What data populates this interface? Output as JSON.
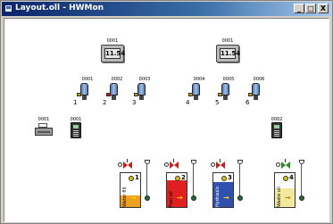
{
  "window": {
    "title": "Layout.oll - HWMon",
    "min_label": "_",
    "max_label": "□",
    "close_label": "X"
  },
  "displays": [
    {
      "tag": "0001",
      "value": "11.54"
    },
    {
      "tag": "0001",
      "value": "11.54"
    }
  ],
  "sensors": [
    {
      "tag": "0001",
      "number": "1",
      "cap": "yellow"
    },
    {
      "tag": "0002",
      "number": "2",
      "cap": "red"
    },
    {
      "tag": "0003",
      "number": "3",
      "cap": "yellow"
    },
    {
      "tag": "0004",
      "number": "4",
      "cap": "yellow"
    },
    {
      "tag": "0005",
      "number": "5",
      "cap": "yellow"
    },
    {
      "tag": "0006",
      "number": "6",
      "cap": "yellow"
    }
  ],
  "devices": {
    "printer_tag": "0001",
    "terminal_left_tag": "0001",
    "terminal_right_tag": "0002"
  },
  "tanks": [
    {
      "number": "1",
      "label": "Water fill",
      "fill_color": "#f0a020",
      "fill_level": 0.35
    },
    {
      "number": "2",
      "label": "Fuel oil",
      "fill_color": "#e02020",
      "fill_level": 0.8
    },
    {
      "number": "3",
      "label": "Hydraulic oil",
      "fill_color": "#3050b0",
      "fill_level": 0.75
    },
    {
      "number": "4",
      "label": "Waste oil",
      "fill_color": "#f2e8a0",
      "fill_level": 0.55
    }
  ],
  "colors": {
    "title_bar": "#0a246a",
    "window_bg": "#d4d0c8",
    "canvas_bg": "#ffffff"
  }
}
